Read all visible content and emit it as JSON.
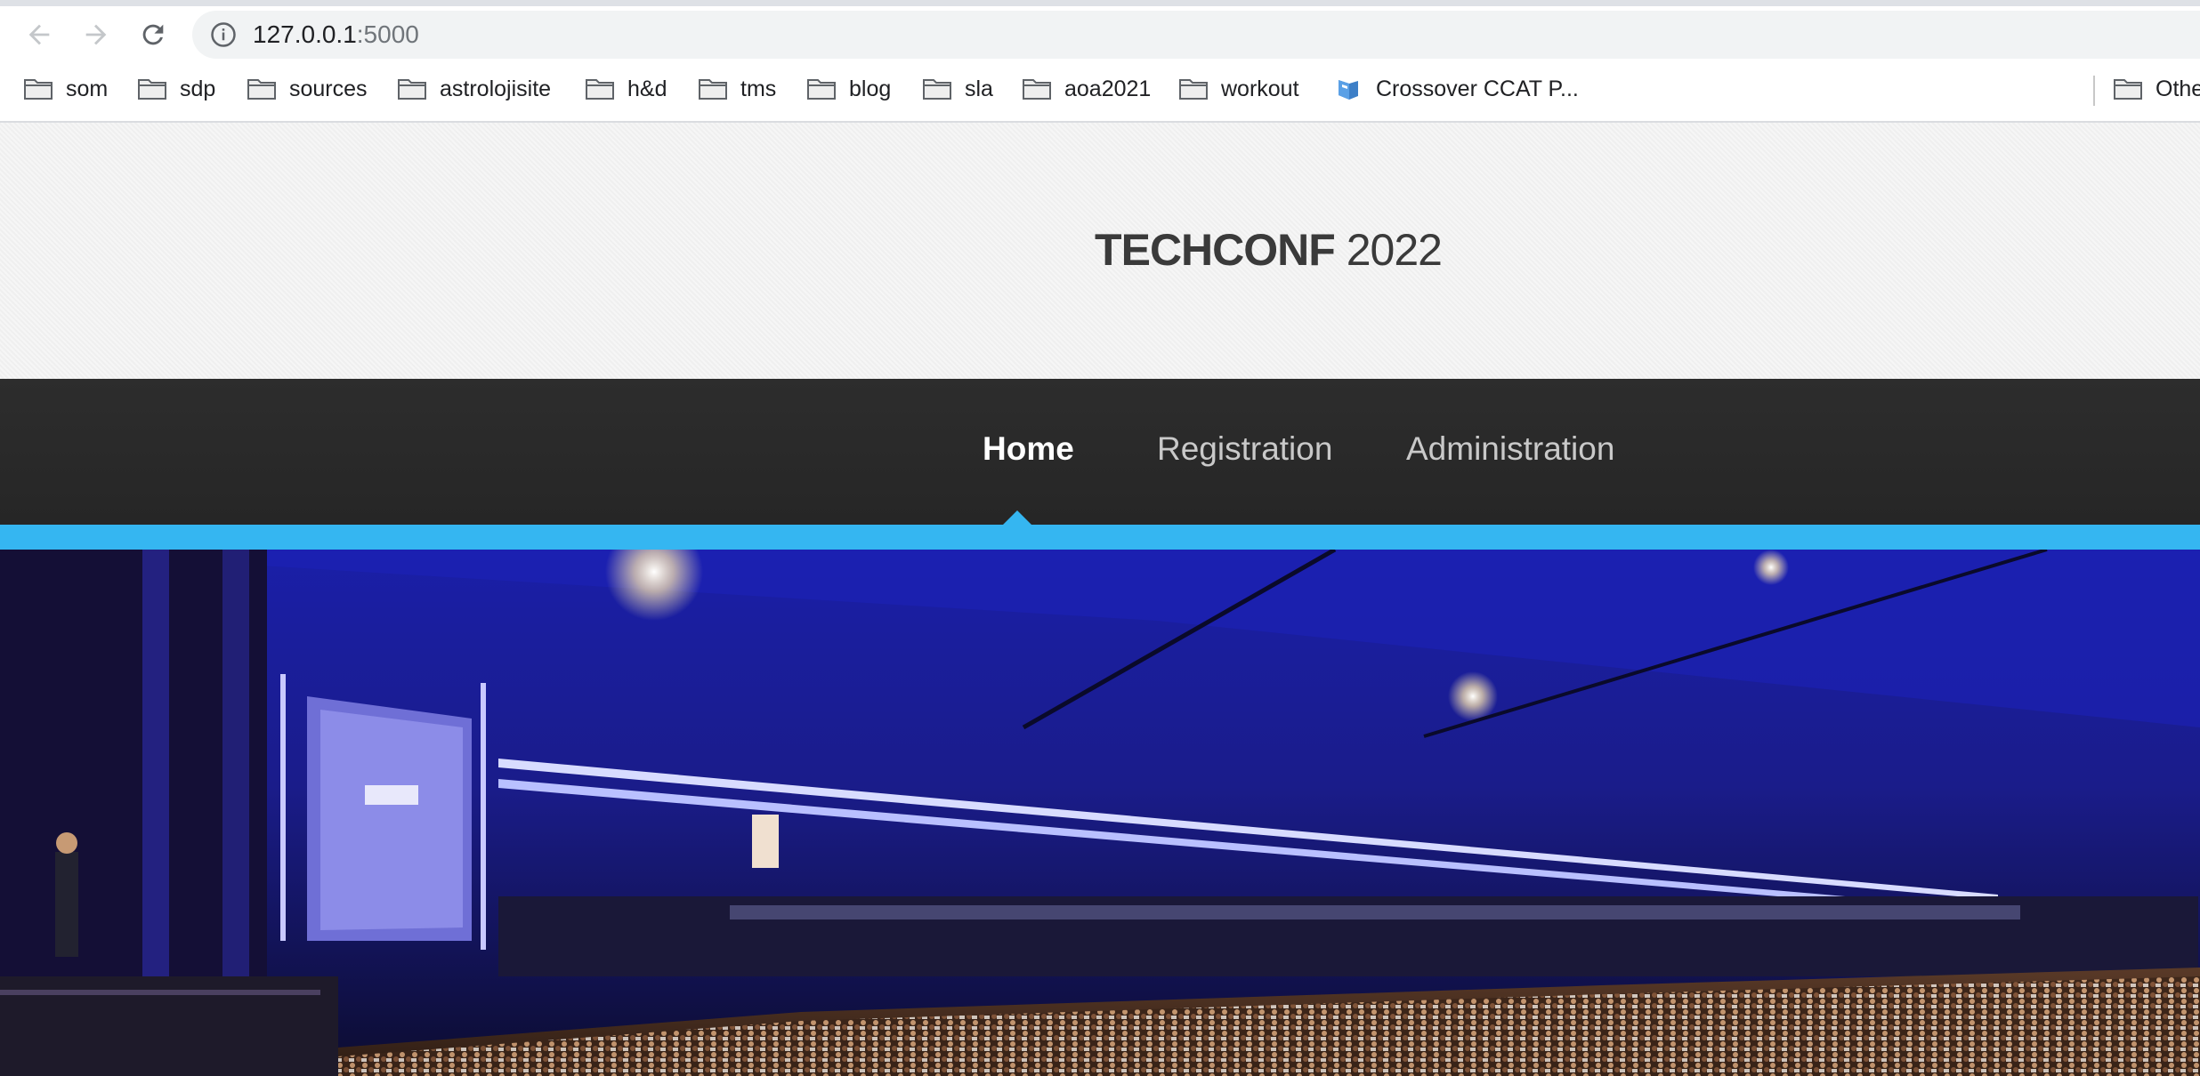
{
  "browser": {
    "nav": {
      "back": "arrow-left-icon",
      "forward": "arrow-right-icon",
      "reload": "reload-icon"
    },
    "address": {
      "host": "127.0.0.1",
      "port": ":5000"
    },
    "bookmarks": [
      {
        "label": "som",
        "icon": "folder-icon"
      },
      {
        "label": "sdp",
        "icon": "folder-icon"
      },
      {
        "label": "sources",
        "icon": "folder-icon"
      },
      {
        "label": "astrolojisite",
        "icon": "folder-icon"
      },
      {
        "label": "h&d",
        "icon": "folder-icon"
      },
      {
        "label": "tms",
        "icon": "folder-icon"
      },
      {
        "label": "blog",
        "icon": "folder-icon"
      },
      {
        "label": "sla",
        "icon": "folder-icon"
      },
      {
        "label": "aoa2021",
        "icon": "folder-icon"
      },
      {
        "label": "workout",
        "icon": "folder-icon"
      },
      {
        "label": "Crossover CCAT P...",
        "icon": "crossover-favicon"
      }
    ],
    "other_bookmarks": {
      "label": "Othe",
      "icon": "folder-icon"
    }
  },
  "site": {
    "title_strong": "TECHCONF",
    "title_light": "2022"
  },
  "nav": {
    "items": [
      {
        "label": "Home",
        "active": true
      },
      {
        "label": "Registration",
        "active": false
      },
      {
        "label": "Administration",
        "active": false
      }
    ]
  },
  "banner": {
    "image": "conference-hall-photo"
  },
  "colors": {
    "accent": "#35b6f1",
    "nav_bg": "#2a2a2a",
    "title_text": "#3a3a3a"
  }
}
